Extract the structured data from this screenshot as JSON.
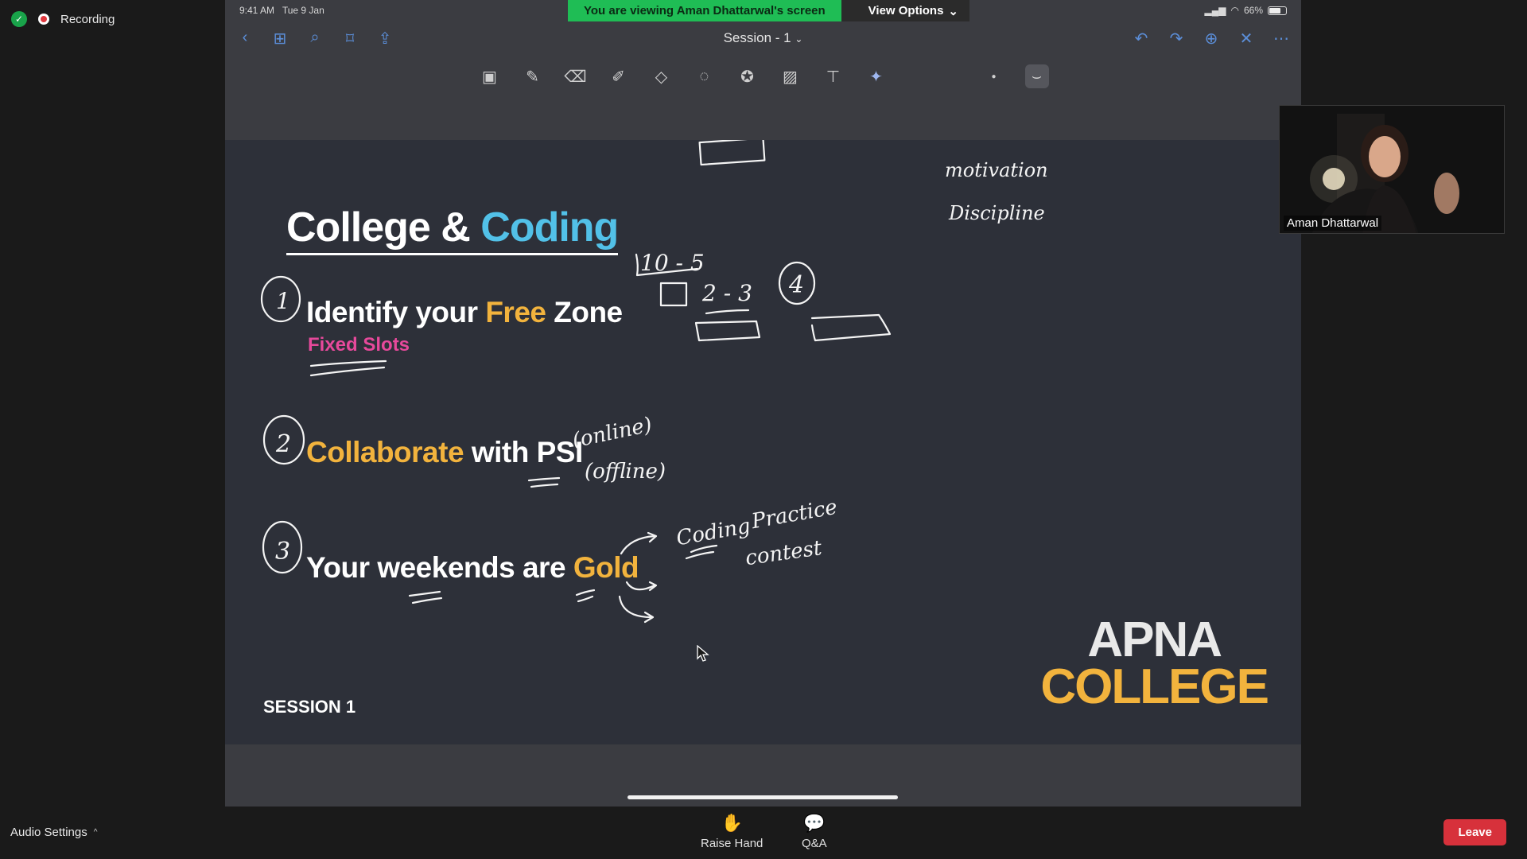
{
  "recording": {
    "label": "Recording"
  },
  "status_bar": {
    "time": "9:41 AM",
    "date": "Tue 9 Jan",
    "battery": "66%"
  },
  "banner": {
    "viewing": "You are viewing Aman Dhattarwal's screen",
    "view_options": "View Options"
  },
  "document": {
    "title": "Session - 1"
  },
  "slide": {
    "title_white": "College & ",
    "title_accent": "Coding",
    "point1": {
      "a": "Identify your ",
      "b": "Free",
      "c": " Zone",
      "sub": "Fixed Slots"
    },
    "point2": {
      "a": "Collaborate",
      "b": " with ",
      "c": "PSI"
    },
    "point3": {
      "a": "Your weekends are ",
      "b": "Gold"
    },
    "session": "SESSION 1",
    "logo_line1": "APNA",
    "logo_line2": "COLLEGE"
  },
  "annotations": {
    "motivation": "motivation",
    "discipline": "Discipline",
    "time_range": "10 - 5",
    "time_range2": "2 - 3",
    "four": "4",
    "online": "(online)",
    "offline": "(offline)",
    "coding": "Coding",
    "practice": "Practice",
    "contest": "contest",
    "n1": "1",
    "n2": "2",
    "n3": "3"
  },
  "participant": {
    "name": "Aman Dhattarwal"
  },
  "bottom": {
    "audio_settings": "Audio Settings",
    "raise_hand": "Raise Hand",
    "qa": "Q&A",
    "leave": "Leave"
  },
  "colors": {
    "accent_blue": "#52c1e8",
    "gold": "#f2b33d",
    "pink": "#e7499b",
    "banner_green": "#1fbd55",
    "leave_red": "#d7313b"
  }
}
